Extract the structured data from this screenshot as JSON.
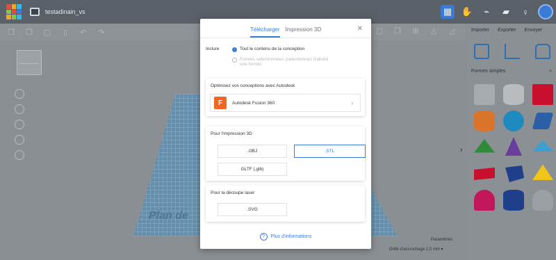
{
  "app": {
    "logo_colors": [
      "#e94c3d",
      "#f5a623",
      "#3cb4e5",
      "#8bc34a",
      "#e94c3d",
      "#3b7bd6",
      "#f5a623",
      "#8bc34a",
      "#3cb4e5"
    ],
    "document_title": "testadinain_vs",
    "accent_color": "#3b7bd6"
  },
  "top_right": {
    "icons": [
      "grid-view-icon",
      "hand-icon",
      "circuit-icon",
      "folder-icon",
      "add-user-icon"
    ]
  },
  "right_panel": {
    "tabs": [
      "Importer",
      "Exporter",
      "Envoyer"
    ],
    "category": "Formes simples",
    "shapes": [
      {
        "name": "box",
        "color": "#a6abb0"
      },
      {
        "name": "cylinder",
        "color": "#b8bcbf"
      },
      {
        "name": "box-red",
        "color": "#c8102e"
      },
      {
        "name": "cylinder-orange",
        "color": "#d9742a"
      },
      {
        "name": "sphere",
        "color": "#1f8ac0"
      },
      {
        "name": "scribble",
        "color": "#2b5fa8"
      },
      {
        "name": "roof",
        "color": "#2e8b3a"
      },
      {
        "name": "cone",
        "color": "#6a3c9e"
      },
      {
        "name": "round-roof",
        "color": "#3c9fd0"
      },
      {
        "name": "text",
        "color": "#c8102e"
      },
      {
        "name": "polygon",
        "color": "#1f3f8a"
      },
      {
        "name": "pyramid",
        "color": "#f0c419"
      },
      {
        "name": "half-sphere",
        "color": "#c2185b"
      },
      {
        "name": "tube",
        "color": "#1f3f8a"
      },
      {
        "name": "paraboloid",
        "color": "#9ba0a5"
      }
    ]
  },
  "canvas": {
    "workplane_label": "Plan de",
    "grid_info": "Paramètres",
    "snap_label": "Grille d'accrochage  1,0 mm ▾"
  },
  "modal": {
    "tabs": [
      "Télécharger",
      "Impression 3D"
    ],
    "active_tab": 0,
    "include_label": "Inclure",
    "option_all": "Tout le contenu de la conception",
    "option_selected": "Formes sélectionnées (sélectionnez d'abord une forme)",
    "optimize_title": "Optimisez vos conceptions avec Autodesk",
    "fusion_label": "Autodesk Fusion 360",
    "fusion_letter": "F",
    "print_title": "Pour l'impression 3D",
    "formats_3d": [
      ".OBJ",
      ".STL",
      "GLTF (.glb)"
    ],
    "selected_format": ".STL",
    "laser_title": "Pour la découpe laser",
    "formats_laser": [
      ".SVG"
    ],
    "more_info": "Plus d'informations"
  }
}
